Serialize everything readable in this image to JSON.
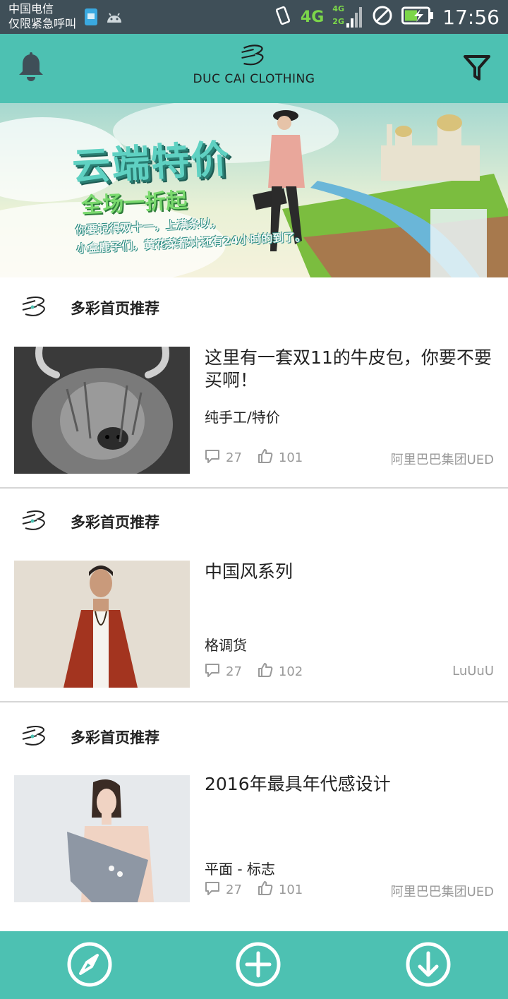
{
  "status_bar": {
    "carrier_line1": "中国电信",
    "carrier_line2": "仅限紧急呼叫",
    "network": "4G",
    "network_small_top": "4G",
    "network_small_bottom": "2G",
    "time": "17:56"
  },
  "app_bar": {
    "brand": "DUC CAI CLOTHING",
    "left_icon": "bell-icon",
    "right_icon": "filter-icon"
  },
  "banner": {
    "title": "云端特价",
    "subtitle": "全场一折起",
    "line1": "你要记得双十一，上满条以，",
    "line2": "小盒鹿子们，黄花菜都计还有24小时的到了。"
  },
  "feed": [
    {
      "section_title": "多彩首页推荐",
      "title": "这里有一套双11的牛皮包，你要不要买啊！",
      "tag": "纯手工/特价",
      "comments": "27",
      "likes": "101",
      "author": "阿里巴巴集团UED"
    },
    {
      "section_title": "多彩首页推荐",
      "title": "中国风系列",
      "tag": "格调货",
      "comments": "27",
      "likes": "102",
      "author": "LuUuU"
    },
    {
      "section_title": "多彩首页推荐",
      "title": "2016年最具年代感设计",
      "tag": "平面 - 标志",
      "comments": "27",
      "likes": "101",
      "author": "阿里巴巴集团UED"
    }
  ],
  "bottom_bar": {
    "items": [
      "compass-icon",
      "add-icon",
      "download-icon"
    ]
  },
  "colors": {
    "accent": "#4dc1b2",
    "status_bar": "#3f4f58",
    "meta_text": "#9a9a9a"
  }
}
